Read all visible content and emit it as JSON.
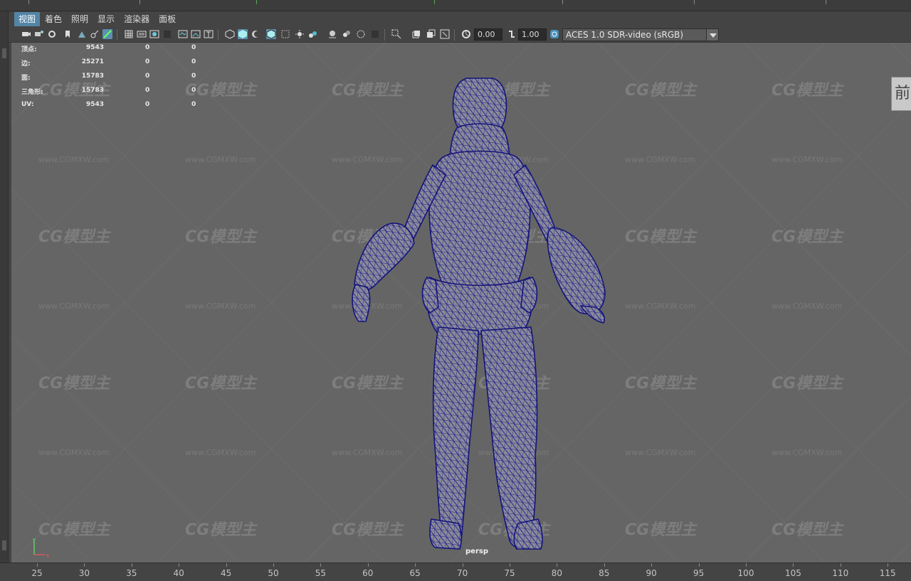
{
  "menubar": {
    "items": [
      {
        "label": "视图",
        "active": true
      },
      {
        "label": "着色",
        "active": false
      },
      {
        "label": "照明",
        "active": false
      },
      {
        "label": "显示",
        "active": false
      },
      {
        "label": "渲染器",
        "active": false
      },
      {
        "label": "面板",
        "active": false
      }
    ]
  },
  "toolbar": {
    "exposure_value": "0.00",
    "gamma_value": "1.00",
    "color_management": "ACES 1.0 SDR-video (sRGB)",
    "icons": [
      "camera-select-icon",
      "camera-attributes-icon",
      "bookmark-icon",
      "image-plane-icon",
      "film-gate-icon",
      "resolution-gate-icon",
      "gate-mask-icon",
      "field-chart-icon",
      "safe-action-icon",
      "safe-title-icon",
      "wireframe-icon",
      "smooth-shade-icon",
      "wireframe-on-shaded-icon",
      "textured-icon",
      "use-lights-icon",
      "shadows-icon",
      "screen-space-ao-icon",
      "motion-blur-icon",
      "multisample-aa-icon",
      "depth-of-field-icon",
      "isolate-select-icon",
      "xray-icon",
      "xray-joints-icon",
      "xray-components-icon",
      "exposure-icon",
      "gamma-icon",
      "color-management-icon"
    ]
  },
  "hud": {
    "rows": [
      {
        "label": "顶点:",
        "v1": "9543",
        "v2": "0",
        "v3": "0"
      },
      {
        "label": "边:",
        "v1": "25271",
        "v2": "0",
        "v3": "0"
      },
      {
        "label": "面:",
        "v1": "15783",
        "v2": "0",
        "v3": "0"
      },
      {
        "label": "三角形:",
        "v1": "15783",
        "v2": "0",
        "v3": "0"
      },
      {
        "label": "UV:",
        "v1": "9543",
        "v2": "0",
        "v3": "0"
      }
    ]
  },
  "viewport": {
    "camera": "persp",
    "view_cube_label": "前",
    "axis_labels": {
      "y": "y",
      "x": "x"
    },
    "wireframe_color": "#1a1a8c",
    "background_color": "#656565",
    "watermark_logo": "CG模型主",
    "watermark_url": "www.CGMXW.com"
  },
  "timeline": {
    "ticks": [
      "25",
      "30",
      "35",
      "40",
      "45",
      "50",
      "55",
      "60",
      "65",
      "70",
      "75",
      "80",
      "85",
      "90",
      "95",
      "100",
      "105",
      "110",
      "115"
    ]
  }
}
